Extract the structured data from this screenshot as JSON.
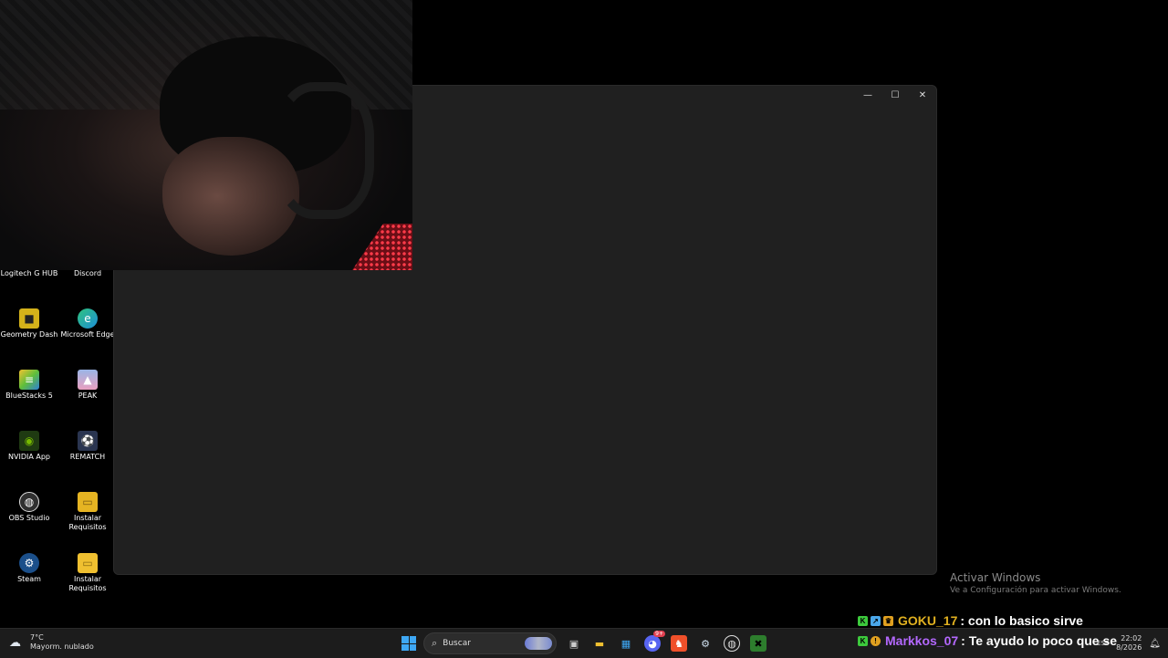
{
  "window": {
    "controls": {
      "minimize": "—",
      "maximize": "☐",
      "close": "✕"
    }
  },
  "desktop_icons": [
    {
      "label": "Logitech G HUB",
      "icon": "logitech-ghub-icon",
      "color": "#1a1a1a",
      "glyph": ""
    },
    {
      "label": "Discord",
      "icon": "discord-icon",
      "color": "#5865f2",
      "glyph": ""
    },
    {
      "label": "Geometry Dash",
      "icon": "geometry-dash-icon",
      "color": "#d4b21a",
      "glyph": "■"
    },
    {
      "label": "Microsoft Edge",
      "icon": "microsoft-edge-icon",
      "color": "#1e8fd8",
      "glyph": "e"
    },
    {
      "label": "BlueStacks 5",
      "icon": "bluestacks-icon",
      "color": "#5fbf3a",
      "glyph": "≡"
    },
    {
      "label": "PEAK",
      "icon": "peak-icon",
      "color": "#9ab5e6",
      "glyph": "▲"
    },
    {
      "label": "NVIDIA App",
      "icon": "nvidia-icon",
      "color": "#1f3a12",
      "glyph": "◉"
    },
    {
      "label": "REMATCH",
      "icon": "rematch-icon",
      "color": "#2a3550",
      "glyph": "⚽"
    },
    {
      "label": "OBS Studio",
      "icon": "obs-icon",
      "color": "#303030",
      "glyph": "◍"
    },
    {
      "label": "Instalar Requisitos",
      "icon": "folder-icon",
      "color": "#e6b422",
      "glyph": "▭"
    },
    {
      "label": "Steam",
      "icon": "steam-icon",
      "color": "#1b4f8a",
      "glyph": "⚙"
    },
    {
      "label": "Instalar Requisitos",
      "icon": "folder-icon",
      "color": "#f0c030",
      "glyph": "▭"
    }
  ],
  "watermark": {
    "title": "Activar Windows",
    "subtitle": "Ve a Configuración para activar Windows."
  },
  "chat": [
    {
      "user": "GOKU_17",
      "user_color": "#e0b020",
      "text": ": con lo basico sirve",
      "badges": [
        "#3cc93c",
        "#4aa6e8",
        "#e0a020"
      ]
    },
    {
      "user": "Markkos_07",
      "user_color": "#b468ff",
      "text": ": Te ayudo lo poco que se",
      "badges": [
        "#3cc93c",
        "#e0a020"
      ]
    }
  ],
  "taskbar": {
    "weather_temp": "7°C",
    "weather_desc": "Mayorm. nublado",
    "search_placeholder": "Buscar",
    "discord_badge": "9+",
    "lang": "ESP",
    "time": "22:02",
    "date": "8/2026"
  }
}
